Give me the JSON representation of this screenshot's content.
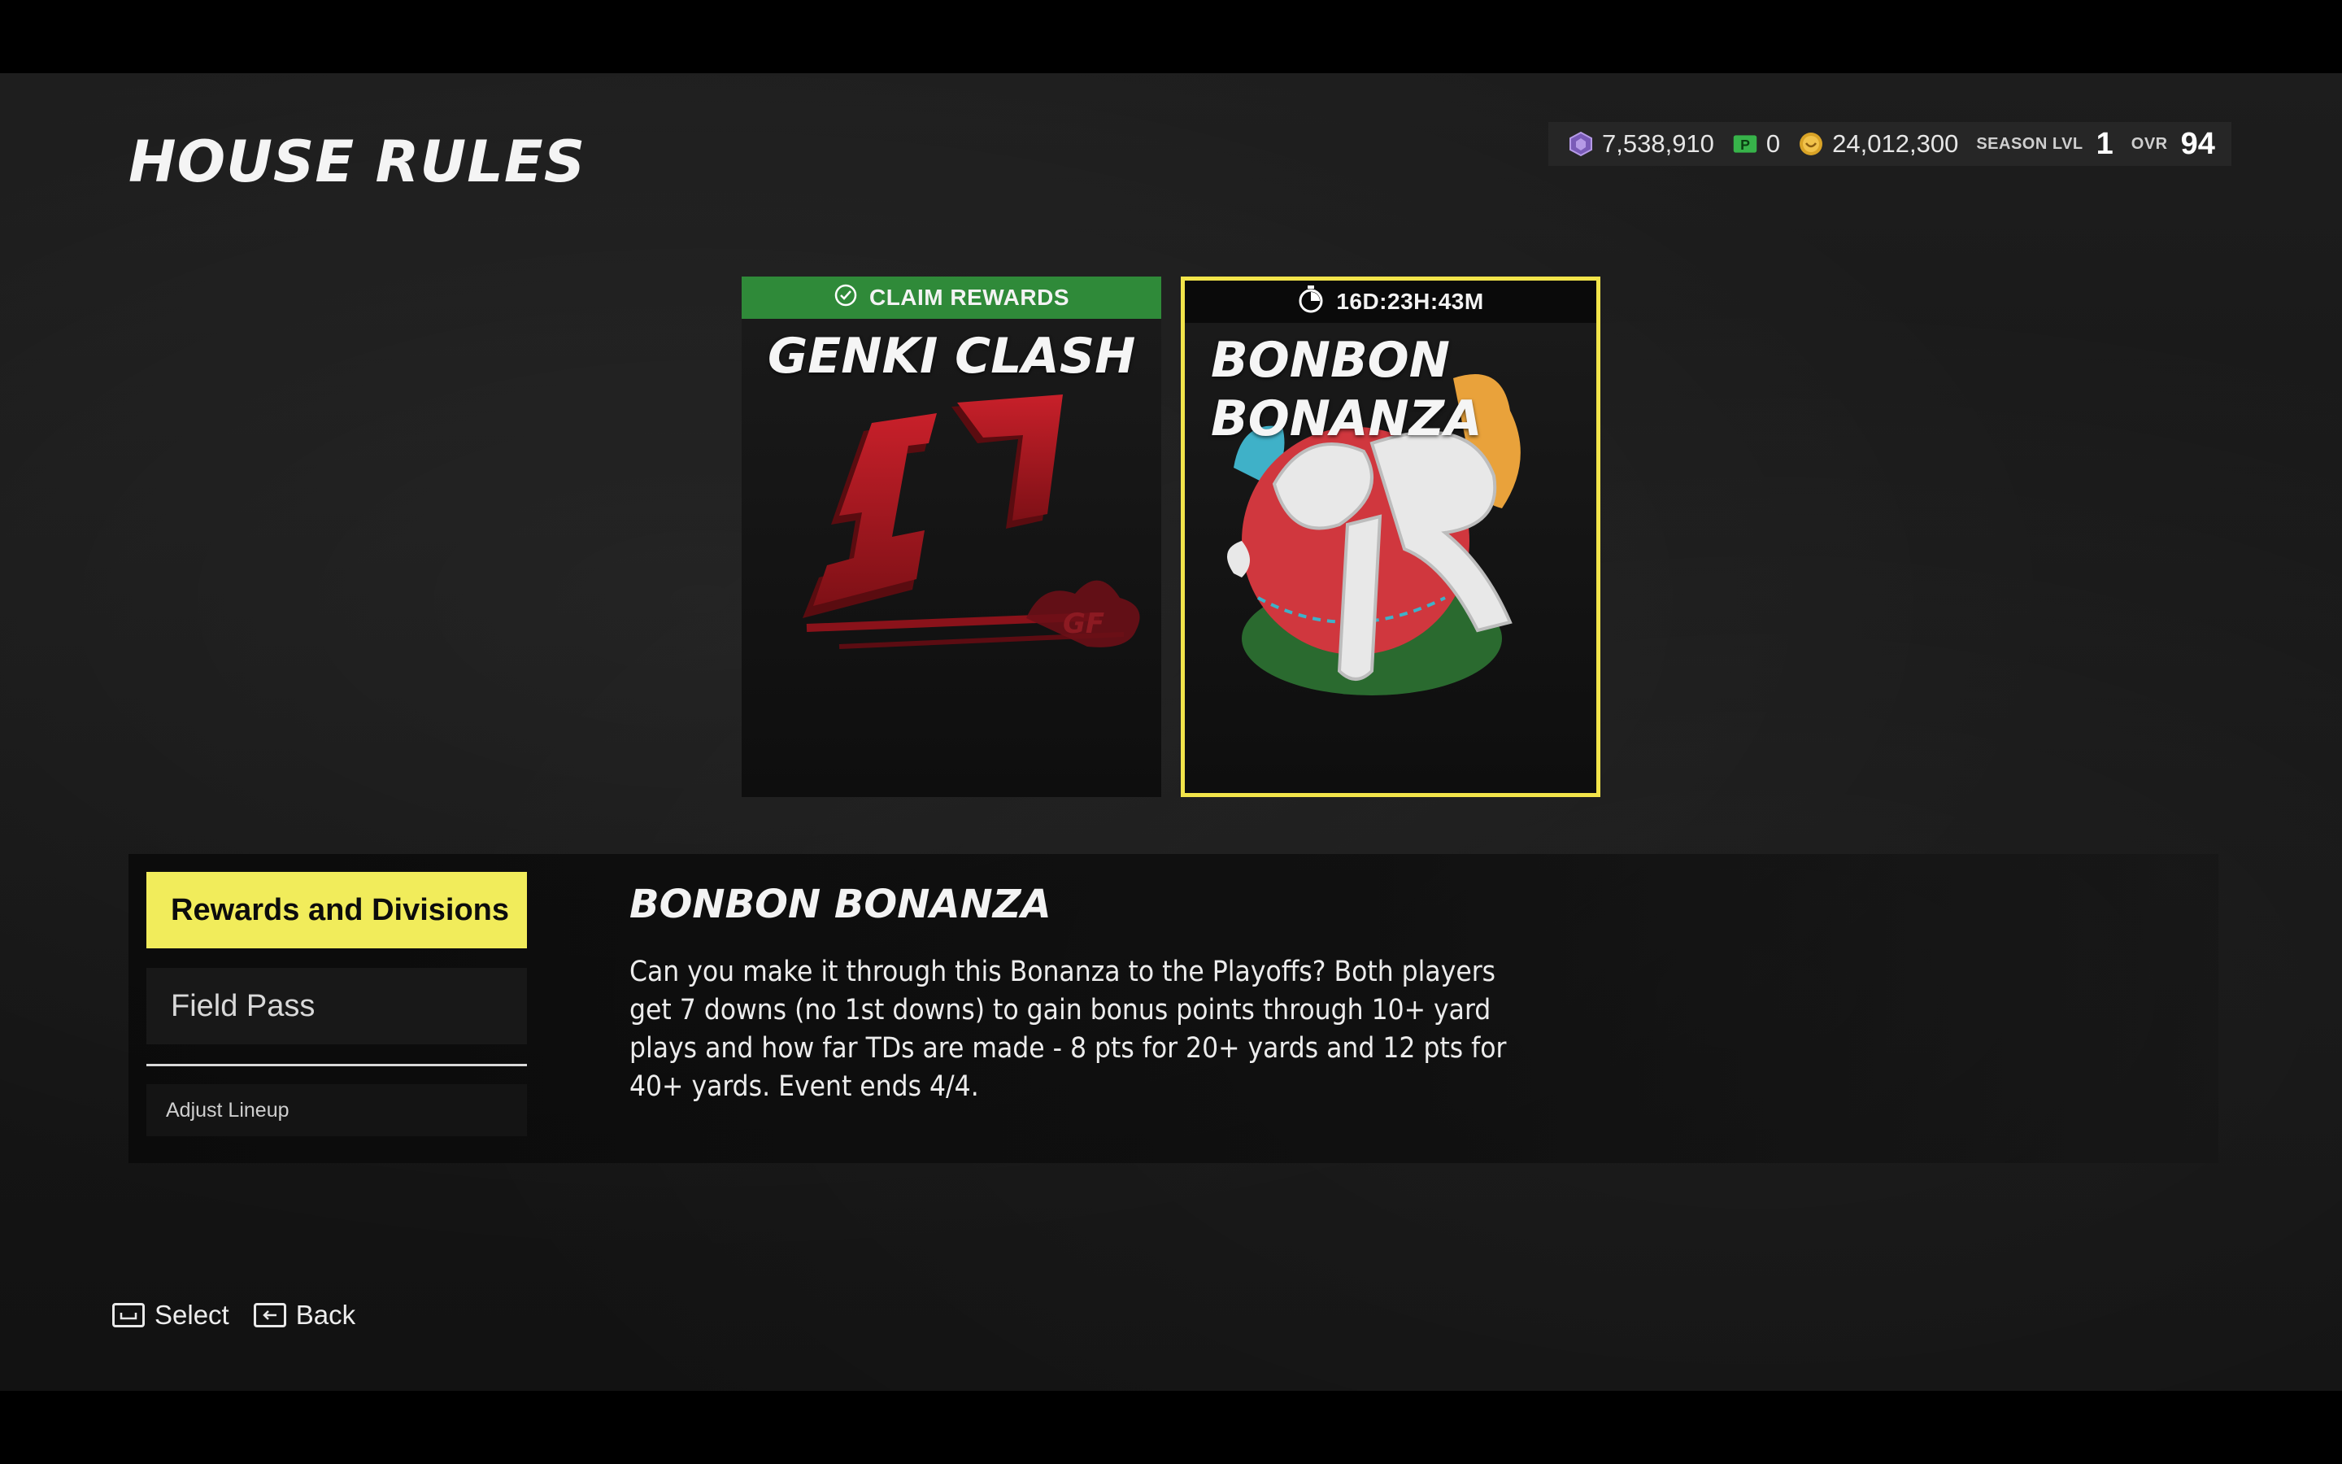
{
  "page_title": "HOUSE RULES",
  "currency": {
    "gems": "7,538,910",
    "points": "0",
    "coins": "24,012,300",
    "season_label": "SEASON LVL",
    "season_value": "1",
    "ovr_label": "OVR",
    "ovr_value": "94"
  },
  "cards": [
    {
      "title": "GENKI CLASH",
      "banner": "CLAIM REWARDS",
      "banner_color": "#2f8a39"
    },
    {
      "title_line1": "BONBON",
      "title_line2": "BONANZA",
      "banner": "16D:23H:43M",
      "selected_border": "#f2e44a"
    }
  ],
  "menu": {
    "items": [
      "Rewards and Divisions",
      "Field Pass",
      "Adjust Lineup"
    ],
    "active_color": "#f1ec5b"
  },
  "description": {
    "title": "BONBON BONANZA",
    "body": "Can you make it through this Bonanza to the Playoffs? Both players get 7 downs (no 1st downs) to gain bonus points through 10+ yard plays and how far TDs are made - 8 pts for 20+ yards and 12 pts for 40+ yards. Event ends 4/4."
  },
  "footer": {
    "select": "Select",
    "back": "Back"
  }
}
